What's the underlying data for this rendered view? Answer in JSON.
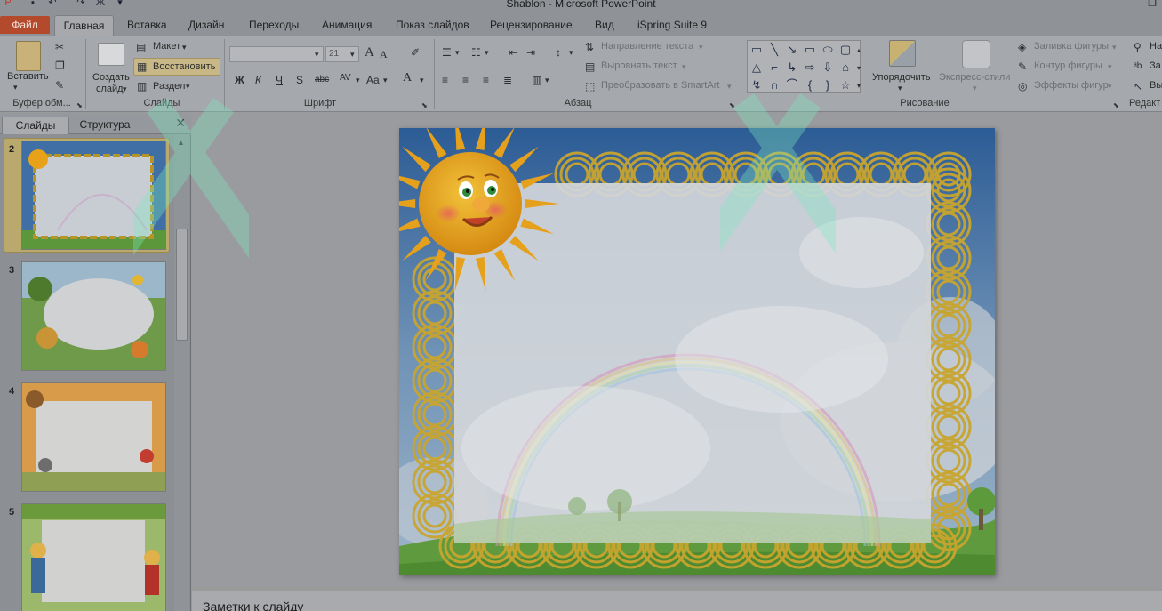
{
  "window": {
    "title": "Shablon  -  Microsoft PowerPoint"
  },
  "tabs": [
    {
      "label": "Файл"
    },
    {
      "label": "Главная"
    },
    {
      "label": "Вставка"
    },
    {
      "label": "Дизайн"
    },
    {
      "label": "Переходы"
    },
    {
      "label": "Анимация"
    },
    {
      "label": "Показ слайдов"
    },
    {
      "label": "Рецензирование"
    },
    {
      "label": "Вид"
    },
    {
      "label": "iSpring Suite 9"
    }
  ],
  "ribbon": {
    "clipboard": {
      "paste_label": "Вставить",
      "group_label": "Буфер обм..."
    },
    "slides": {
      "new_slide_line1": "Создать",
      "new_slide_line2": "слайд",
      "layout_label": "Макет",
      "reset_label": "Восстановить",
      "section_label": "Раздел",
      "group_label": "Слайды"
    },
    "font": {
      "font_size": "21",
      "bold": "Ж",
      "italic": "К",
      "underline": "Ч",
      "shadow": "S",
      "strike": "abc",
      "spacing": "AV",
      "case": "Aa",
      "grow": "A",
      "shrink": "A",
      "color": "A",
      "group_label": "Шрифт"
    },
    "paragraph": {
      "text_direction": "Направление текста",
      "align_text": "Выровнять текст",
      "convert_smartart": "Преобразовать в SmartArt",
      "group_label": "Абзац"
    },
    "drawing": {
      "arrange_label": "Упорядочить",
      "quick_styles_label": "Экспресс-стили",
      "shape_fill": "Заливка фигуры",
      "shape_outline": "Контур фигуры",
      "shape_effects": "Эффекты фигур",
      "group_label": "Рисование"
    },
    "editing": {
      "find_cut": "На",
      "replace_cut": "За",
      "select_cut": "Вы",
      "group_label": "Редакт"
    }
  },
  "left_panel": {
    "tab_slides": "Слайды",
    "tab_outline": "Структура",
    "thumbnails": [
      {
        "number": "2"
      },
      {
        "number": "3"
      },
      {
        "number": "4"
      },
      {
        "number": "5"
      }
    ]
  },
  "notes": {
    "placeholder": "Заметки к слайду"
  },
  "colors": {
    "file_tab": "#b44a2c",
    "selected_slide_border": "#b9a96d",
    "sky": "#3f6fa4",
    "grass": "#5f9b3e",
    "sun": "#e8a21a",
    "frame_gold": "#c9a52e"
  }
}
